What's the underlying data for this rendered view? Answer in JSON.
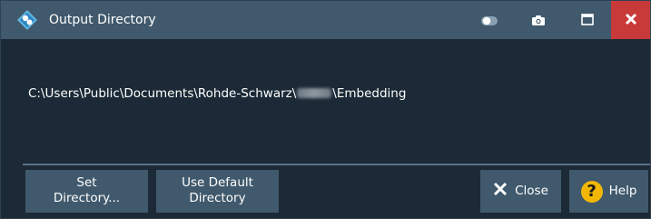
{
  "window": {
    "title": "Output Directory",
    "close_color": "#c8393a",
    "titlebar_color": "#40596c",
    "background_color": "#1b2a36"
  },
  "icons": {
    "app_logo": "rohde-schwarz-logo-icon",
    "toggle": "toggle-switch-icon",
    "camera": "camera-icon",
    "maximize": "maximize-icon",
    "close": "close-icon",
    "help": "help-icon"
  },
  "content": {
    "path_prefix": "C:\\Users\\Public\\Documents\\Rohde-Schwarz\\",
    "path_suffix": "\\Embedding"
  },
  "buttons": {
    "set_directory_line1": "Set",
    "set_directory_line2": "Directory...",
    "use_default_line1": "Use Default",
    "use_default_line2": "Directory",
    "close": "Close",
    "help": "Help"
  }
}
